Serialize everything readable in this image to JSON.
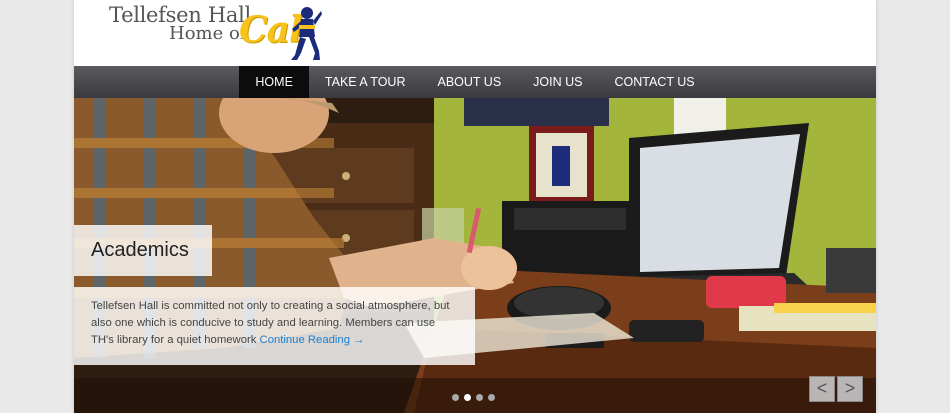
{
  "logo": {
    "line1": "Tellefsen Hall",
    "line2": "Home of",
    "cal": "Cal"
  },
  "nav": {
    "items": [
      {
        "label": "HOME",
        "active": true
      },
      {
        "label": "TAKE A TOUR",
        "active": false
      },
      {
        "label": "ABOUT US",
        "active": false
      },
      {
        "label": "JOIN US",
        "active": false
      },
      {
        "label": "CONTACT US",
        "active": false
      }
    ]
  },
  "slide": {
    "title": "Academics",
    "text": "Tellefsen Hall is committed not only to creating a social atmosphere, but also one which is conducive to study and learning. Members can use TH's library for a quiet homework",
    "link": "Continue Reading →"
  },
  "slider": {
    "current": 2,
    "total": 4,
    "prev": "<",
    "next": ">"
  },
  "colors": {
    "nav_bg": "#4a4a4f",
    "nav_active": "#0c0c0c",
    "link": "#1f7fd0",
    "cal_gold": "#f7c21a",
    "bear_blue": "#1c2b7a"
  }
}
